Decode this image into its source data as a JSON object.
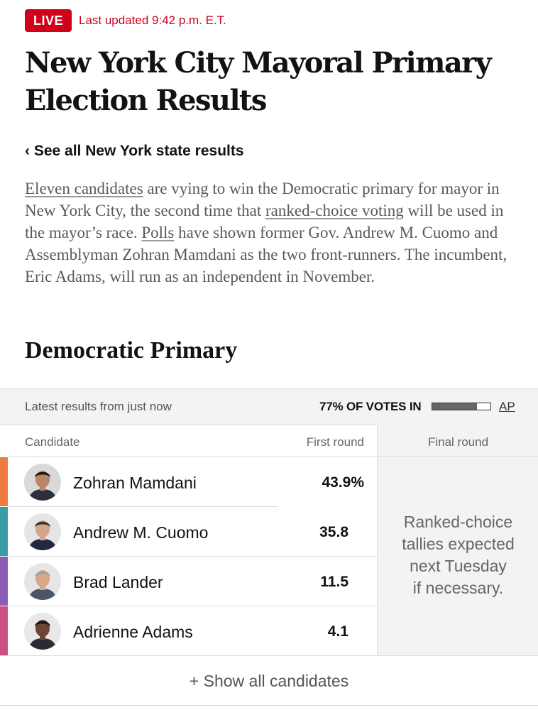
{
  "header": {
    "live_label": "LIVE",
    "updated_text": "Last updated 9:42 p.m. E.T.",
    "title_line1": "New York City Mayoral Primary",
    "title_line2": "Election Results",
    "back_link": "‹ See all New York state results"
  },
  "intro": {
    "link_candidates": "Eleven candidates",
    "text_1": " are vying to win the Democratic primary for mayor in New York City, the second time that ",
    "link_rcv": "ranked-choice voting",
    "text_2": " will be used in the mayor’s race. ",
    "link_polls": "Polls",
    "text_3": " have shown former Gov. Andrew M. Cuomo and Assemblyman Zohran Mamdani as the two front-runners. The incumbent, Eric Adams, will run as an independent in November."
  },
  "section": {
    "title": "Democratic Primary"
  },
  "status": {
    "latest_text": "Latest results from just now",
    "votes_in": "77% OF VOTES IN",
    "votes_in_fraction": 0.77,
    "source": "AP"
  },
  "table": {
    "col_candidate": "Candidate",
    "col_first_round": "First round",
    "col_final_round": "Final round",
    "final_note_lines": [
      "Ranked-choice",
      "tallies expected",
      "next Tuesday",
      "if necessary."
    ],
    "candidates": [
      {
        "name": "Zohran Mamdani",
        "pct": "43.9%",
        "color": "#ee7b3f",
        "skin": "#b98567",
        "hair": "#1f1a17",
        "shirt": "#2a2f3a",
        "bg": "#d9d9d9"
      },
      {
        "name": "Andrew M. Cuomo",
        "pct": "35.8",
        "color": "#3a9ca5",
        "skin": "#d4a58a",
        "hair": "#3b342f",
        "shirt": "#23293a",
        "bg": "#e5e5e5"
      },
      {
        "name": "Brad Lander",
        "pct": "11.5",
        "color": "#8a5bb7",
        "skin": "#d8a88c",
        "hair": "#a3a19c",
        "shirt": "#4a5668",
        "bg": "#e6e6e6"
      },
      {
        "name": "Adrienne Adams",
        "pct": "4.1",
        "color": "#c94f84",
        "skin": "#6c4632",
        "hair": "#1d1713",
        "shirt": "#2d2a33",
        "bg": "#e8e8e8"
      }
    ]
  },
  "footer": {
    "show_all": "+ Show all candidates"
  }
}
